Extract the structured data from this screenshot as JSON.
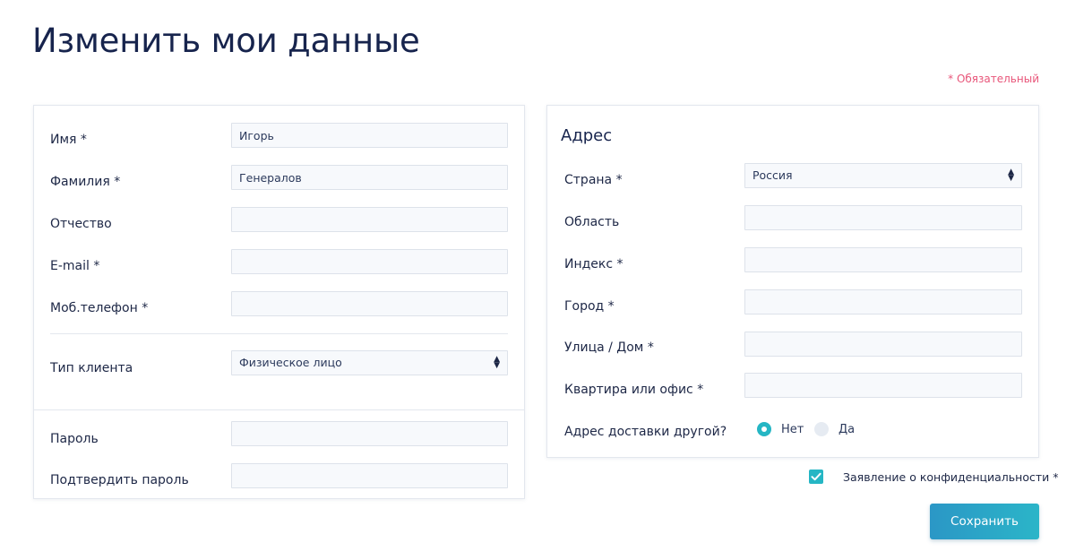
{
  "page": {
    "title": "Изменить мои данные",
    "required_note": "* Обязательный"
  },
  "personal": {
    "first_name": {
      "label": "Имя *",
      "value": "Игорь"
    },
    "last_name": {
      "label": "Фамилия *",
      "value": "Генералов"
    },
    "patronymic": {
      "label": "Отчество",
      "value": ""
    },
    "email": {
      "label": "E-mail *",
      "value": ""
    },
    "mobile": {
      "label": "Моб.телефон *",
      "value": ""
    },
    "client_type": {
      "label": "Тип клиента",
      "value": "Физическое лицо"
    },
    "password": {
      "label": "Пароль",
      "value": ""
    },
    "confirm_password": {
      "label": "Подтвердить пароль",
      "value": ""
    }
  },
  "address": {
    "title": "Адрес",
    "country": {
      "label": "Страна *",
      "value": "Россия"
    },
    "region": {
      "label": "Область",
      "value": ""
    },
    "postcode": {
      "label": "Индекс *",
      "value": ""
    },
    "city": {
      "label": "Город *",
      "value": ""
    },
    "street": {
      "label": "Улица / Дом *",
      "value": ""
    },
    "apartment": {
      "label": "Квартира или офис *",
      "value": ""
    },
    "other_delivery": {
      "label": "Адрес доставки другой?",
      "options": [
        "Нет",
        "Да"
      ],
      "selected": "Нет"
    }
  },
  "privacy": {
    "label": "Заявление о конфиденциальности *",
    "checked": true
  },
  "actions": {
    "save_label": "Сохранить"
  },
  "colors": {
    "accent": "#25b6c4",
    "required": "#e8567a",
    "title": "#17244d"
  },
  "icons": {
    "select_arrows": "sort-arrows-icon",
    "check": "checkmark-icon"
  }
}
